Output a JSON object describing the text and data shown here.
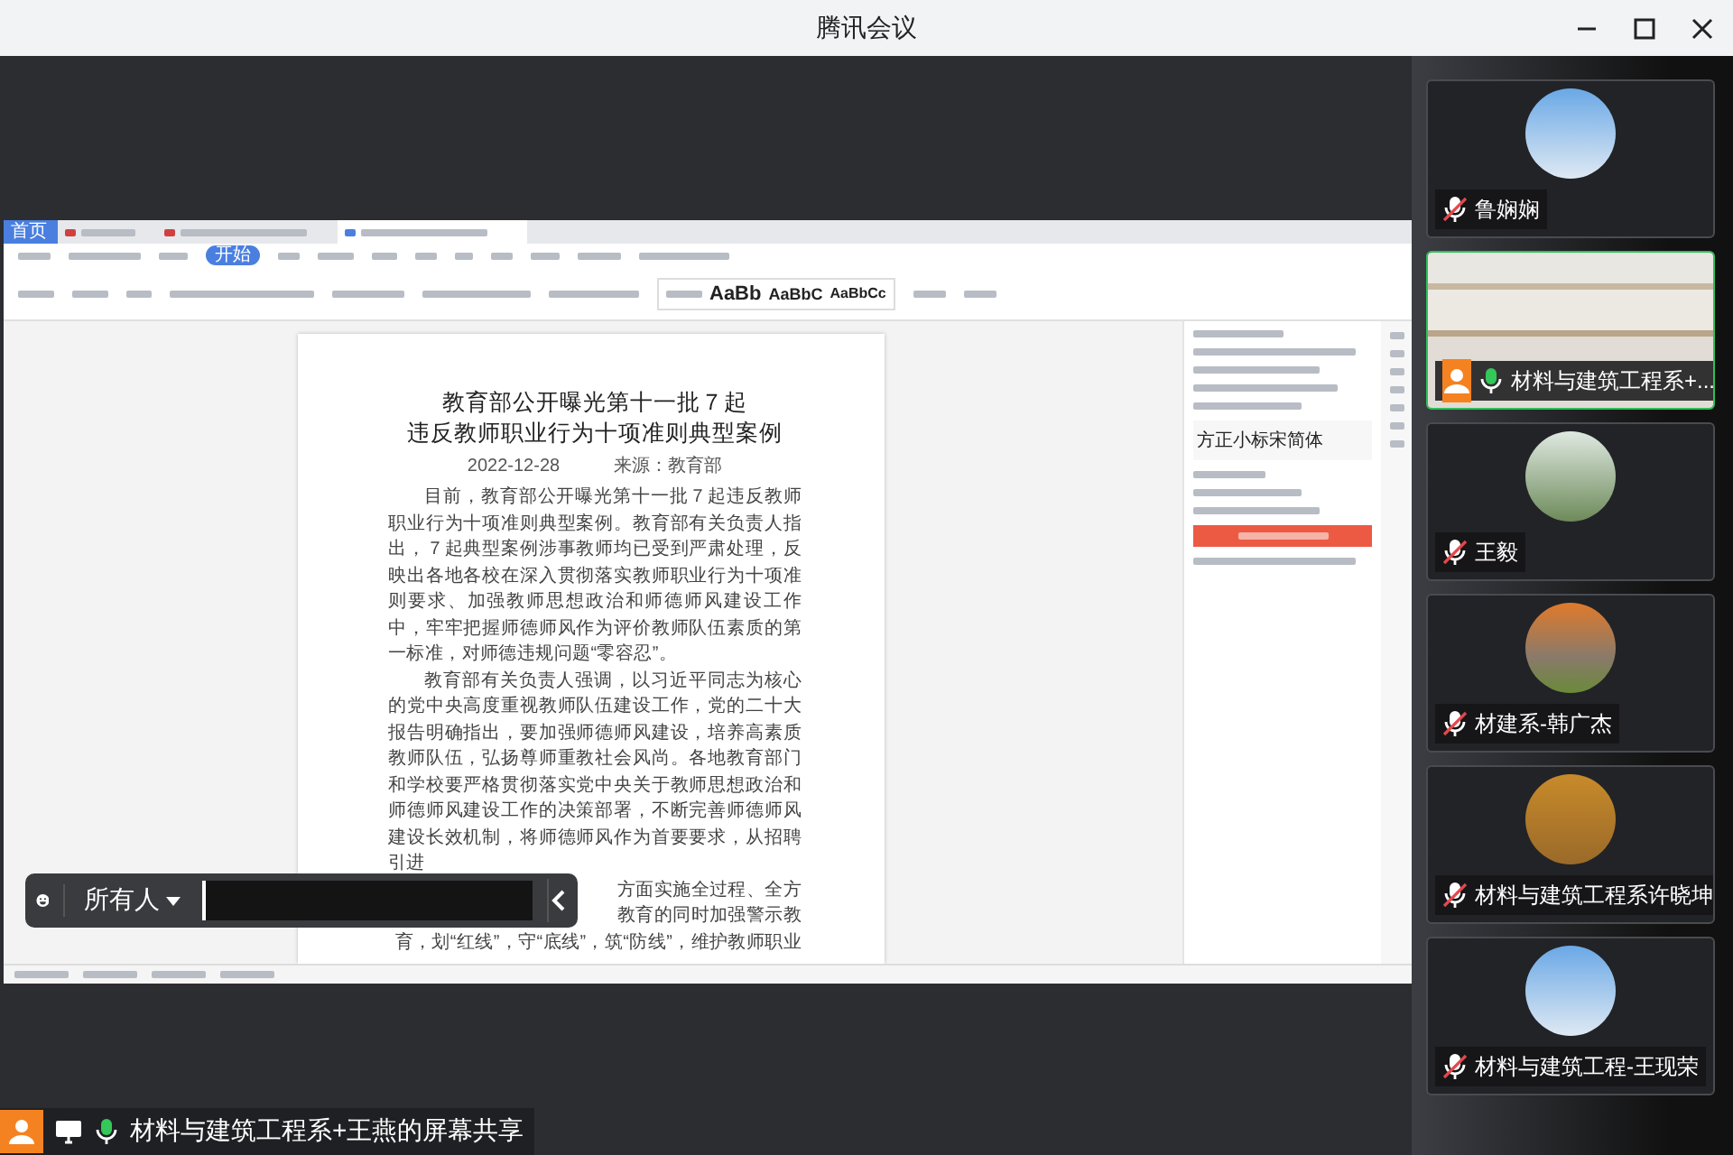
{
  "window": {
    "title": "腾讯会议"
  },
  "shared_screen": {
    "tabs": [
      {
        "label": "首页",
        "selected": false
      },
      {
        "selected": false
      },
      {
        "selected": false
      },
      {
        "selected": true
      }
    ],
    "ribbon_tab": "开始",
    "style_previews": [
      "AaBb",
      "AaBbC",
      "AaBbCc"
    ],
    "document": {
      "title_lines": [
        "教育部公开曝光第十一批７起",
        "违反教师职业行为十项准则典型案例"
      ],
      "date": "2022-12-28",
      "source": "来源：教育部",
      "paragraphs": [
        "目前，教育部公开曝光第十一批７起违反教师职业行为十项准则典型案例。教育部有关负责人指出，７起典型案例涉事教师均已受到严肃处理，反映出各地各校在深入贯彻落实教师职业行为十项准则要求、加强教师思想政治和师德师风建设工作中，牢牢把握师德师风作为评价教师队伍素质的第一标准，对师德违规问题“零容忍”。",
        "教育部有关负责人强调，以习近平同志为核心的党中央高度重视教师队伍建设工作，党的二十大报告明确指出，要加强师德师风建设，培养高素质教师队伍，弘扬尊师重教社会风尚。各地教育部门和学校要严格贯彻落实党中央关于教师思想政治和师德师风建设工作的决策部署，不断完善师德师风建设长效机制，将师德师风作为首要要求，从招聘引进"
      ],
      "tail_lines": [
        "方面实施全过程、全方",
        "教育的同时加强警示教",
        "育，划“红线”，守“底线”，筑“防线”，维护教师职业"
      ]
    },
    "side_panel": {
      "font_name": "方正小标宋简体"
    },
    "chat_bar": {
      "recipient": "所有人"
    }
  },
  "sharing_label": "材料与建筑工程系+王燕的屏幕共享",
  "participants": [
    {
      "name": "鲁娴娴",
      "muted": true,
      "kind": "avatar",
      "selected": false
    },
    {
      "name": "材料与建筑工程系+...",
      "muted": false,
      "kind": "video",
      "selected": true
    },
    {
      "name": "王毅",
      "muted": true,
      "kind": "avatar",
      "selected": false
    },
    {
      "name": "材建系-韩广杰",
      "muted": true,
      "kind": "avatar",
      "selected": false
    },
    {
      "name": "材料与建筑工程系许晓坤",
      "muted": true,
      "kind": "avatar",
      "selected": false
    },
    {
      "name": "材料与建筑工程-王现荣",
      "muted": true,
      "kind": "avatar",
      "selected": false
    }
  ]
}
